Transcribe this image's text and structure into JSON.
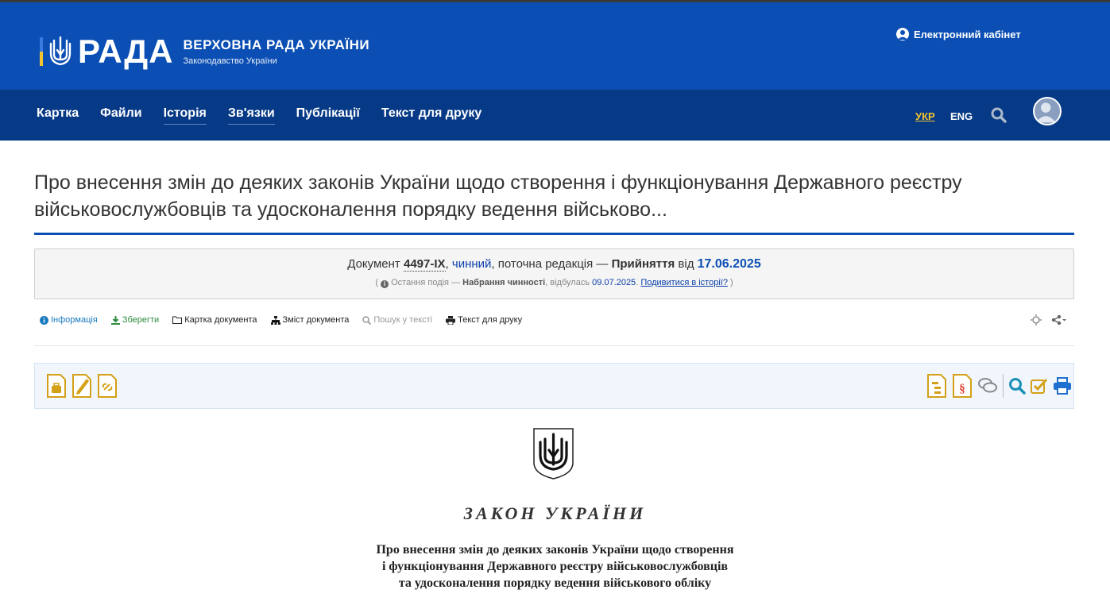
{
  "header": {
    "brand": "РАДА",
    "org_name": "ВЕРХОВНА РАДА УКРАЇНИ",
    "org_sub": "Законодавство України",
    "cabinet": "Електронний кабінет",
    "colors": {
      "header_bg": "#0b4fb4",
      "nav_bg": "#073a86",
      "accent_lang": "#f4c430"
    }
  },
  "nav": {
    "items": [
      "Картка",
      "Файли",
      "Історія",
      "Зв'язки",
      "Публікації",
      "Текст для друку"
    ],
    "lang_ukr": "УКР",
    "lang_eng": "ENG"
  },
  "title": {
    "line1": "Про внесення змін до деяких законів України щодо створення і функціонування Державного реєстру",
    "line2": "військовослужбовців та удосконалення порядку ведення військово..."
  },
  "docinfo": {
    "prefix": "Документ",
    "number": "4497-IX",
    "sep1": ", ",
    "status": "чинний",
    "sep2": ", поточна редакція — ",
    "edition": "Прийняття",
    "from": " від ",
    "date": "17.06.2025",
    "paren_open": "( ",
    "last_event_label": "Остання подія — ",
    "last_event": "Набрання чинності",
    "happened": ", відбулась ",
    "event_date": "09.07.2025",
    "dot": ". ",
    "history_link": "Подивитися в історії?",
    "paren_close": " )"
  },
  "toolbar": {
    "info": "Інформація",
    "save": "Зберегти",
    "card": "Картка документа",
    "contents": "Зміст документа",
    "search": "Пошук у тексті",
    "print": "Текст для друку"
  },
  "document": {
    "law_title": "ЗАКОН УКРАЇНИ",
    "sub1": "Про внесення змін до деяких законів України щодо створення",
    "sub2": "і функціонування Державного реєстру військовослужбовців",
    "sub3": "та удосконалення порядку ведення військового обліку"
  }
}
